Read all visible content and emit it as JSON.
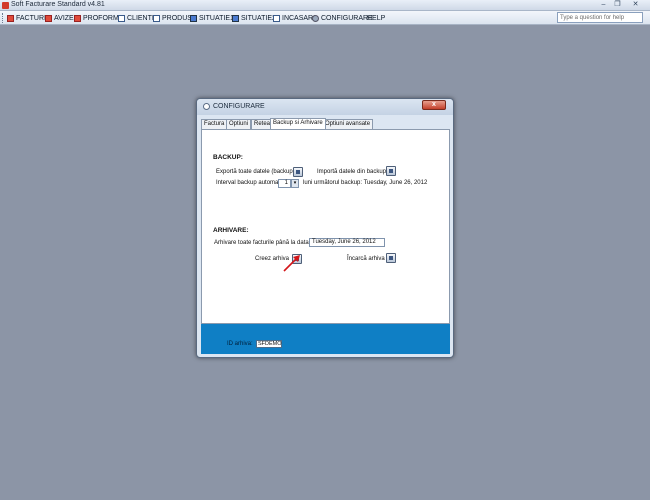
{
  "app": {
    "title": "Soft Facturare Standard v4.81",
    "window_controls": {
      "minimize": "–",
      "restore": "❐",
      "close": "✕"
    }
  },
  "menu": {
    "items": [
      {
        "label": "FACTURI",
        "icon": "document-red-icon"
      },
      {
        "label": "AVIZE",
        "icon": "document-red-icon"
      },
      {
        "label": "PROFORME",
        "icon": "document-red-icon"
      },
      {
        "label": "CLIENTI",
        "icon": "list-icon"
      },
      {
        "label": "PRODUSE",
        "icon": "list-icon"
      },
      {
        "label": "SITUATIE1",
        "icon": "report-icon"
      },
      {
        "label": "SITUATIE2",
        "icon": "report-icon"
      },
      {
        "label": "INCASARI",
        "icon": "report-icon"
      },
      {
        "label": "CONFIGURARE",
        "icon": "gear-icon"
      },
      {
        "label": "HELP",
        "icon": ""
      }
    ],
    "help_search_placeholder": "Type a question for help"
  },
  "dialog": {
    "title": "CONFIGURARE",
    "close_label": "x",
    "tabs": [
      {
        "label": "Factura",
        "active": false
      },
      {
        "label": "Optiuni",
        "active": false
      },
      {
        "label": "Retea",
        "active": false
      },
      {
        "label": "Backup si Arhivare",
        "active": true
      },
      {
        "label": "Optiuni avansate",
        "active": false
      }
    ],
    "backup": {
      "heading": "BACKUP:",
      "export_label": "Exportă toate datele (backup):",
      "import_label": "Importă datele din backup:",
      "interval_label": "Interval backup automat:",
      "interval_value": "1",
      "next_backup_text": "luni următorul backup: Tuesday, June 26, 2012"
    },
    "archive": {
      "heading": "ARHIVARE:",
      "archive_until_label": "Arhivare toate facturile până la data:",
      "archive_until_value": "Tuesday, June 26, 2012",
      "create_label": "Creez arhiva",
      "load_label": "Încarcă arhiva"
    },
    "footer": {
      "label": "ID arhiva:",
      "value": "SFDEMO",
      "color": "#0f7fc5"
    }
  }
}
